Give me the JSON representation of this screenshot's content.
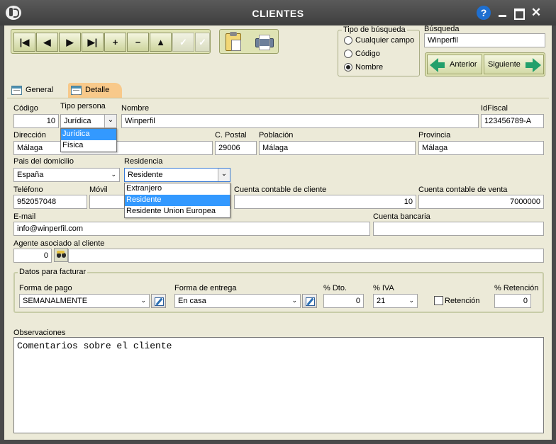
{
  "window": {
    "title": "CLIENTES",
    "help_icon": "?",
    "close_glyph": "✕"
  },
  "toolbar": {
    "buttons": [
      "|◀",
      "◀",
      "▶",
      "▶|",
      "+",
      "−",
      "▲",
      "",
      "",
      ""
    ]
  },
  "search_type": {
    "label": "Tipo de búsqueda",
    "options": [
      "Cualquier campo",
      "Código",
      "Nombre"
    ],
    "selected": "Nombre"
  },
  "search": {
    "label": "Búsqueda",
    "value": "Winperfil"
  },
  "nav": {
    "prev": "Anterior",
    "next": "Siguiente"
  },
  "tabs": [
    "General",
    "Detalle"
  ],
  "active_tab": "Detalle",
  "form": {
    "codigo": {
      "label": "Código",
      "value": "10"
    },
    "tipo_persona": {
      "label": "Tipo persona",
      "value": "Jurídica",
      "options": [
        "Jurídica",
        "Física"
      ],
      "highlighted": "Jurídica"
    },
    "nombre": {
      "label": "Nombre",
      "value": "Winperfil"
    },
    "idfiscal": {
      "label": "IdFiscal",
      "value": "123456789-A"
    },
    "direccion": {
      "label": "Dirección",
      "value": "Málaga"
    },
    "cpostal": {
      "label": "C. Postal",
      "value": "29006"
    },
    "poblacion": {
      "label": "Población",
      "value": "Málaga"
    },
    "provincia": {
      "label": "Provincia",
      "value": "Málaga"
    },
    "pais": {
      "label": "Pais del domicilio",
      "value": "España"
    },
    "residencia": {
      "label": "Residencia",
      "value": "Residente",
      "options": [
        "Extranjero",
        "Residente",
        "Residente Union Europea"
      ],
      "highlighted": "Residente"
    },
    "telefono": {
      "label": "Teléfono",
      "value": "952057048"
    },
    "movil": {
      "label": "Móvil",
      "value": ""
    },
    "cta_cliente": {
      "label": "Cuenta contable de cliente",
      "value": "10"
    },
    "cta_venta": {
      "label": "Cuenta contable de venta",
      "value": "7000000"
    },
    "email": {
      "label": "E-mail",
      "value": "info@winperfil.com"
    },
    "cta_bancaria": {
      "label": "Cuenta bancaria",
      "value": ""
    },
    "agente": {
      "label": "Agente asociado al cliente",
      "value": "0",
      "name": ""
    }
  },
  "facturar": {
    "label": "Datos para facturar",
    "forma_pago": {
      "label": "Forma de pago",
      "value": "SEMANALMENTE"
    },
    "forma_entrega": {
      "label": "Forma de entrega",
      "value": "En casa"
    },
    "dto": {
      "label": "% Dto.",
      "value": "0"
    },
    "iva": {
      "label": "% IVA",
      "value": "21"
    },
    "retencion_check": {
      "label": "Retención",
      "checked": false
    },
    "retencion": {
      "label": "% Retención",
      "value": "0"
    }
  },
  "observaciones": {
    "label": "Observaciones",
    "value": "Comentarios sobre el cliente"
  },
  "icons": [
    "app-logo-icon",
    "help-icon",
    "minimize-icon",
    "maximize-icon",
    "close-icon",
    "first-record-icon",
    "previous-record-icon",
    "next-record-icon",
    "last-record-icon",
    "add-icon",
    "delete-icon",
    "up-icon",
    "accept-icon",
    "cancel-icon",
    "clipboard-icon",
    "printer-icon",
    "arrow-left-icon",
    "arrow-right-icon",
    "binoculars-icon",
    "edit-icon"
  ],
  "colors": {
    "titlebar": "#4a4a4a",
    "panel": "#ecead8",
    "toolbar": "#dfe3b4",
    "active_tab": "#f8c98a",
    "selection": "#3399ff",
    "nav_arrow": "#22a06b"
  }
}
